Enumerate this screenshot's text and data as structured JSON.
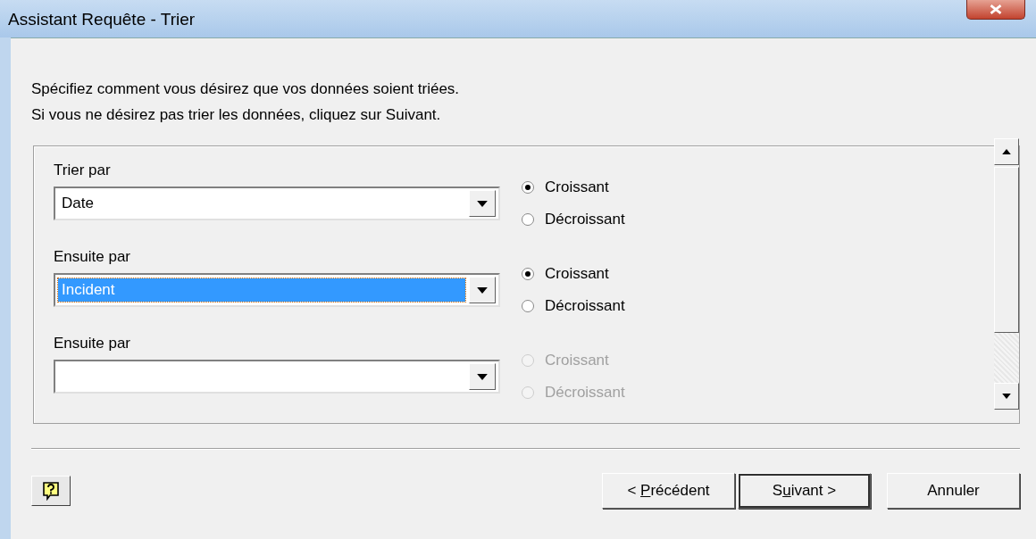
{
  "window": {
    "title": "Assistant Requête - Trier"
  },
  "instructions": [
    "Spécifiez comment vous désirez que vos données soient triées.",
    "Si vous ne désirez pas trier les données, cliquez sur Suivant."
  ],
  "sort_levels": [
    {
      "label": "Trier par",
      "value": "Date",
      "focused": false,
      "disabled": false,
      "orders": [
        {
          "label": "Croissant",
          "selected": true
        },
        {
          "label": "Décroissant",
          "selected": false
        }
      ]
    },
    {
      "label": "Ensuite par",
      "value": "Incident",
      "focused": true,
      "disabled": false,
      "orders": [
        {
          "label": "Croissant",
          "selected": true
        },
        {
          "label": "Décroissant",
          "selected": false
        }
      ]
    },
    {
      "label": "Ensuite par",
      "focused": false,
      "disabled": true,
      "orders": [
        {
          "label": "Croissant",
          "selected": false
        },
        {
          "label": "Décroissant",
          "selected": false
        }
      ]
    }
  ],
  "buttons": [
    {
      "label_parts": [
        "< ",
        "P",
        "récédent"
      ],
      "default": false
    },
    {
      "label_parts": [
        "S",
        "u",
        "ivant >"
      ],
      "default": true
    },
    {
      "label_parts": [
        "Annuler"
      ],
      "default": false
    }
  ]
}
